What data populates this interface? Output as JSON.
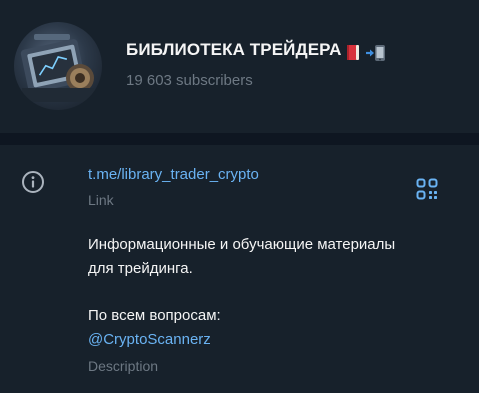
{
  "channel": {
    "title": "БИБЛИОТЕКА ТРЕЙДЕРА",
    "title_emojis": [
      "red-book-icon",
      "mobile-phone-arrow-icon"
    ],
    "subscribers": "19 603 subscribers",
    "avatar": "trading-book-avatar"
  },
  "info": {
    "link": {
      "value": "t.me/library_trader_crypto",
      "label": "Link"
    },
    "description": {
      "lines": [
        "Информационные и обучающие материалы",
        "для трейдинга.",
        "По всем вопросам:"
      ],
      "mention": "@CryptoScannerz",
      "label": "Description"
    }
  },
  "colors": {
    "background": "#17212b",
    "divider": "#0e1621",
    "primary_text": "#f5f5f5",
    "secondary_text": "#6d7883",
    "link": "#6ab3f3",
    "icon": "#aab3bd"
  }
}
